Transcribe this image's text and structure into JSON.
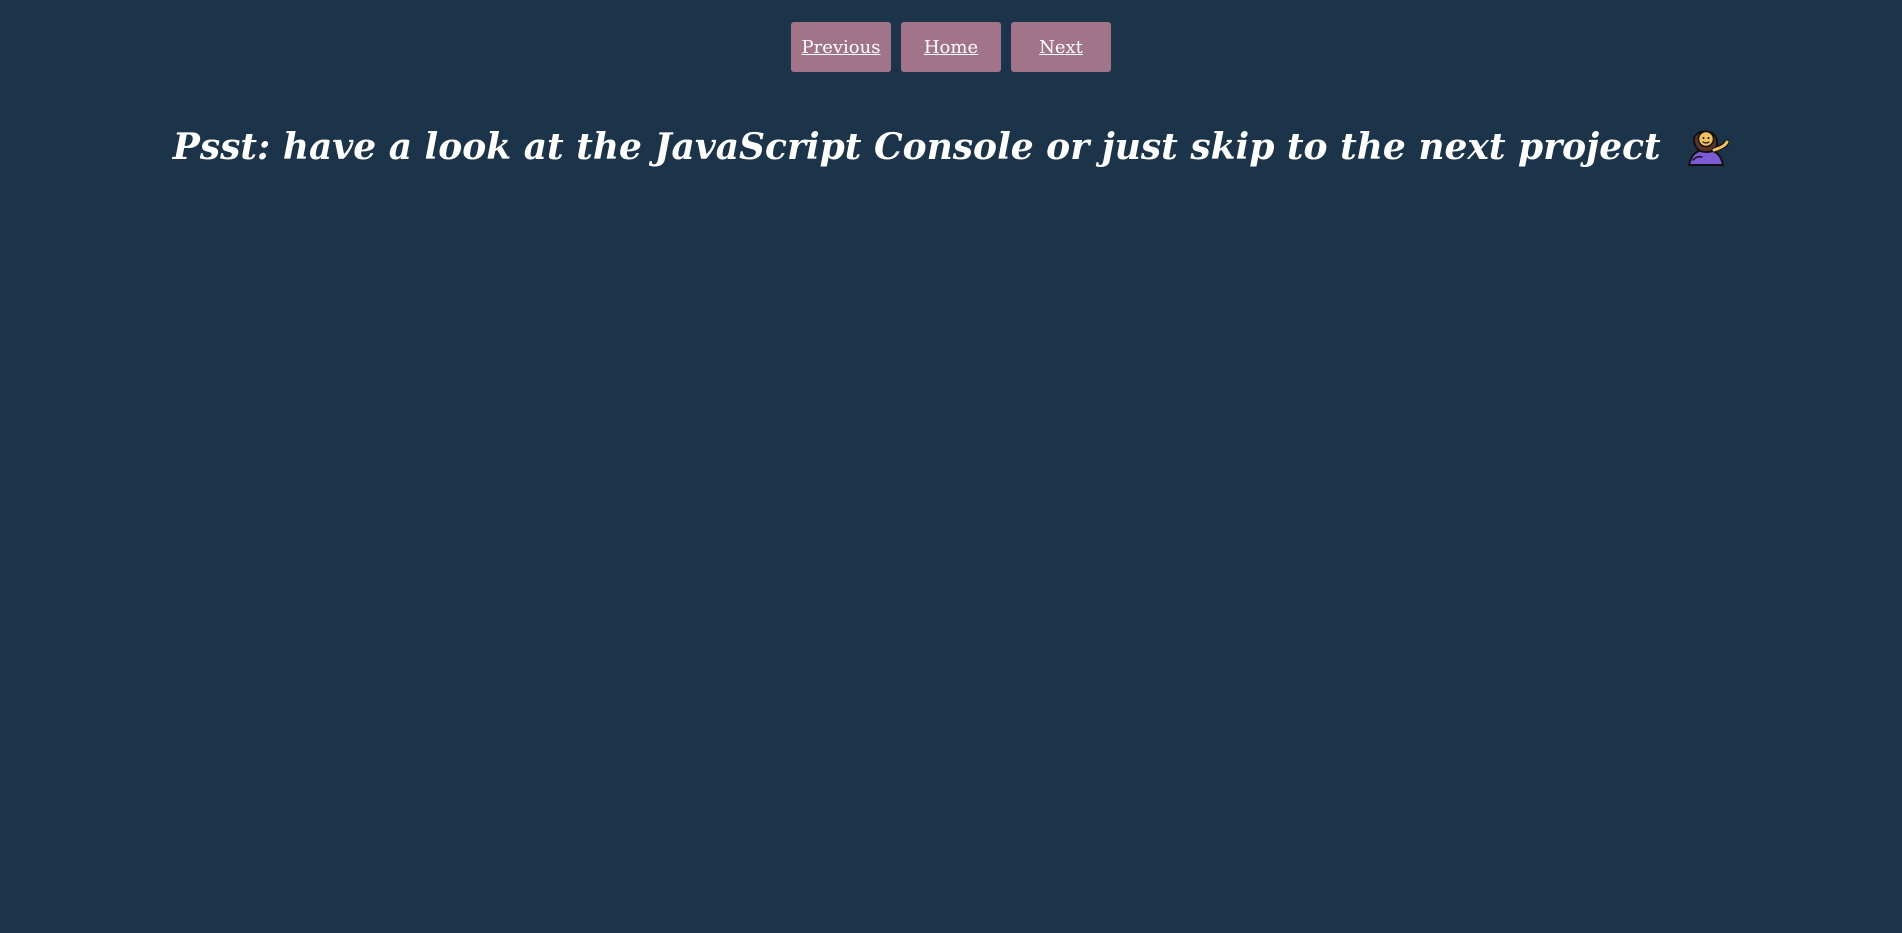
{
  "nav": {
    "previous_label": "Previous",
    "home_label": "Home",
    "next_label": "Next"
  },
  "main": {
    "message": "Psst: have a look at the JavaScript Console or just skip to the next project",
    "emoji_icon": "woman-tipping-hand-icon"
  },
  "colors": {
    "background": "#1b3449",
    "button": "#a17489",
    "text": "#ffffff"
  }
}
